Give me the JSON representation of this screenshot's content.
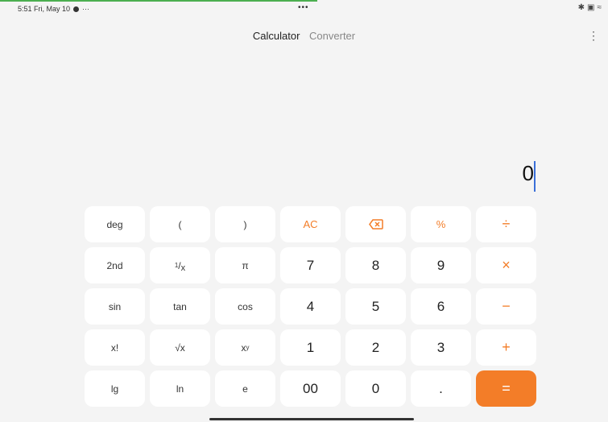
{
  "status": {
    "time_date": "5:51  Fri, May 10",
    "more": "···",
    "center": "•••",
    "icons": [
      "bluetooth-icon",
      "screen-icon",
      "wifi-icon"
    ]
  },
  "tabs": [
    {
      "label": "Calculator"
    },
    {
      "label": "Converter"
    }
  ],
  "display": {
    "value": "0"
  },
  "keys": {
    "deg": "deg",
    "lparen": "(",
    "rparen": ")",
    "ac": "AC",
    "percent": "%",
    "divide": "÷",
    "second": "2nd",
    "pi": "π",
    "n7": "7",
    "n8": "8",
    "n9": "9",
    "multiply": "×",
    "sin": "sin",
    "tan": "tan",
    "cos": "cos",
    "n4": "4",
    "n5": "5",
    "n6": "6",
    "minus": "−",
    "fact": "x!",
    "sqrt": "√x",
    "pow_base": "x",
    "pow_exp": "y",
    "n1": "1",
    "n2": "2",
    "n3": "3",
    "plus": "+",
    "lg": "lg",
    "ln": "ln",
    "e": "e",
    "n00": "00",
    "n0": "0",
    "dot": ".",
    "equals": "=",
    "recip_num": "1",
    "recip_den": "x"
  },
  "colors": {
    "accent": "#f37d28",
    "background": "#f4f4f4",
    "key": "#ffffff",
    "cursor": "#3a6fd8"
  }
}
